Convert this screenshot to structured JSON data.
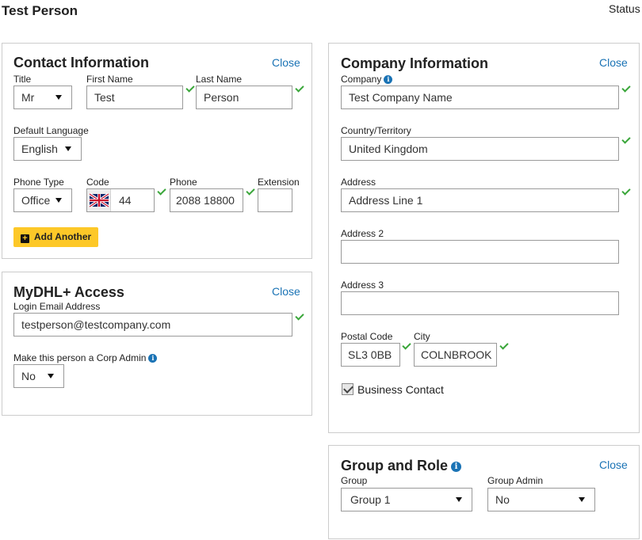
{
  "header": {
    "title": "Test Person",
    "status_label": "Status"
  },
  "contact": {
    "title": "Contact Information",
    "close": "Close",
    "labels": {
      "title": "Title",
      "first_name": "First Name",
      "last_name": "Last Name",
      "language": "Default Language",
      "phone_type": "Phone Type",
      "code": "Code",
      "phone": "Phone",
      "extension": "Extension"
    },
    "values": {
      "title": "Mr",
      "first_name": "Test",
      "last_name": "Person",
      "language": "English",
      "phone_type": "Office",
      "code": "44",
      "phone": "2088 18800",
      "extension": ""
    },
    "add_another": "Add Another"
  },
  "access": {
    "title": "MyDHL+ Access",
    "close": "Close",
    "email_label": "Login Email Address",
    "email_value": "testperson@testcompany.com",
    "admin_label": "Make this person a Corp Admin",
    "admin_value": "No"
  },
  "company": {
    "title": "Company Information",
    "close": "Close",
    "labels": {
      "company": "Company",
      "country": "Country/Territory",
      "address": "Address",
      "address2": "Address 2",
      "address3": "Address 3",
      "postal": "Postal Code",
      "city": "City"
    },
    "values": {
      "company": "Test Company Name",
      "country": "United Kingdom",
      "address": "Address Line 1",
      "address2": "",
      "address3": "",
      "postal": "SL3 0BB",
      "city": "COLNBROOK"
    },
    "business_contact": "Business Contact"
  },
  "group": {
    "title": "Group and Role",
    "close": "Close",
    "group_label": "Group",
    "group_value": "Group 1",
    "admin_label": "Group Admin",
    "admin_value": "No"
  },
  "icons": {
    "info": "info-icon",
    "check": "checkmark-icon",
    "flag": "uk-flag-icon",
    "plus": "plus-icon",
    "caret": "caret-down-icon"
  },
  "colors": {
    "accent": "#1a73b5",
    "button": "#fdc828",
    "valid": "#3aa63a"
  }
}
